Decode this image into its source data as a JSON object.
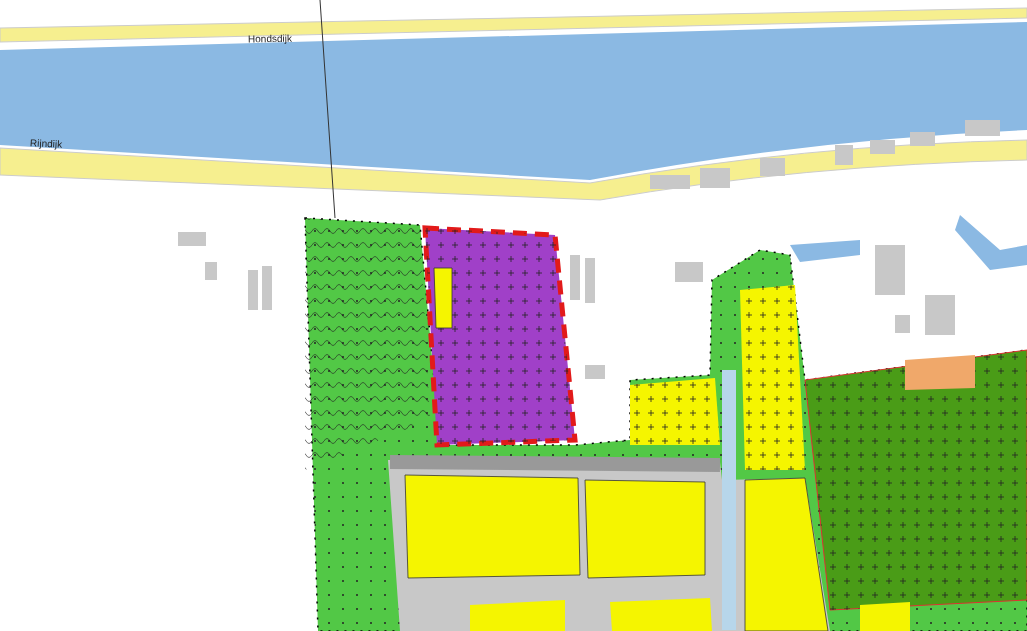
{
  "map": {
    "labels": [
      {
        "text": "Hondsdijk"
      },
      {
        "text": "Rijndijk"
      }
    ]
  }
}
